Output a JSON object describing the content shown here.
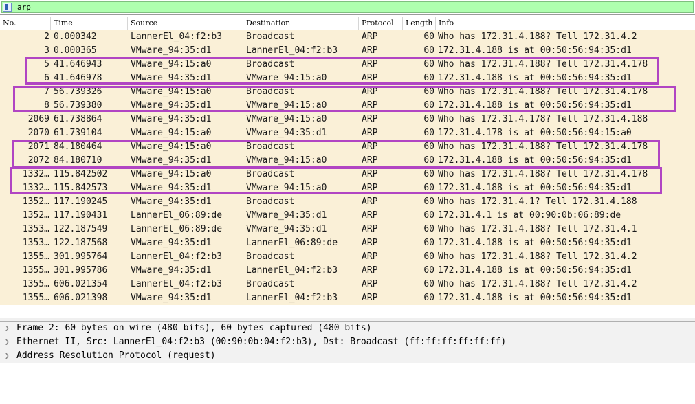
{
  "filter": {
    "value": "arp",
    "icon": "bookmark-icon",
    "colors": {
      "valid_bg": "#afffaf"
    }
  },
  "columns": [
    "No.",
    "Time",
    "Source",
    "Destination",
    "Protocol",
    "Length",
    "Info"
  ],
  "packets": [
    {
      "no": "2",
      "time": "0.000342",
      "src": "LannerEl_04:f2:b3",
      "dst": "Broadcast",
      "proto": "ARP",
      "len": "60",
      "info": "Who has 172.31.4.188? Tell 172.31.4.2"
    },
    {
      "no": "3",
      "time": "0.000365",
      "src": "VMware_94:35:d1",
      "dst": "LannerEl_04:f2:b3",
      "proto": "ARP",
      "len": "60",
      "info": "172.31.4.188 is at 00:50:56:94:35:d1"
    },
    {
      "no": "5",
      "time": "41.646943",
      "src": "VMware_94:15:a0",
      "dst": "Broadcast",
      "proto": "ARP",
      "len": "60",
      "info": "Who has 172.31.4.188? Tell 172.31.4.178"
    },
    {
      "no": "6",
      "time": "41.646978",
      "src": "VMware_94:35:d1",
      "dst": "VMware_94:15:a0",
      "proto": "ARP",
      "len": "60",
      "info": "172.31.4.188 is at 00:50:56:94:35:d1"
    },
    {
      "no": "7",
      "time": "56.739326",
      "src": "VMware_94:15:a0",
      "dst": "Broadcast",
      "proto": "ARP",
      "len": "60",
      "info": "Who has 172.31.4.188? Tell 172.31.4.178"
    },
    {
      "no": "8",
      "time": "56.739380",
      "src": "VMware_94:35:d1",
      "dst": "VMware_94:15:a0",
      "proto": "ARP",
      "len": "60",
      "info": "172.31.4.188 is at 00:50:56:94:35:d1"
    },
    {
      "no": "2069",
      "time": "61.738864",
      "src": "VMware_94:35:d1",
      "dst": "VMware_94:15:a0",
      "proto": "ARP",
      "len": "60",
      "info": "Who has 172.31.4.178? Tell 172.31.4.188"
    },
    {
      "no": "2070",
      "time": "61.739104",
      "src": "VMware_94:15:a0",
      "dst": "VMware_94:35:d1",
      "proto": "ARP",
      "len": "60",
      "info": "172.31.4.178 is at 00:50:56:94:15:a0"
    },
    {
      "no": "2071",
      "time": "84.180464",
      "src": "VMware_94:15:a0",
      "dst": "Broadcast",
      "proto": "ARP",
      "len": "60",
      "info": "Who has 172.31.4.188? Tell 172.31.4.178"
    },
    {
      "no": "2072",
      "time": "84.180710",
      "src": "VMware_94:35:d1",
      "dst": "VMware_94:15:a0",
      "proto": "ARP",
      "len": "60",
      "info": "172.31.4.188 is at 00:50:56:94:35:d1"
    },
    {
      "no": "1332…",
      "time": "115.842502",
      "src": "VMware_94:15:a0",
      "dst": "Broadcast",
      "proto": "ARP",
      "len": "60",
      "info": "Who has 172.31.4.188? Tell 172.31.4.178"
    },
    {
      "no": "1332…",
      "time": "115.842573",
      "src": "VMware_94:35:d1",
      "dst": "VMware_94:15:a0",
      "proto": "ARP",
      "len": "60",
      "info": "172.31.4.188 is at 00:50:56:94:35:d1"
    },
    {
      "no": "1352…",
      "time": "117.190245",
      "src": "VMware_94:35:d1",
      "dst": "Broadcast",
      "proto": "ARP",
      "len": "60",
      "info": "Who has 172.31.4.1? Tell 172.31.4.188"
    },
    {
      "no": "1352…",
      "time": "117.190431",
      "src": "LannerEl_06:89:de",
      "dst": "VMware_94:35:d1",
      "proto": "ARP",
      "len": "60",
      "info": "172.31.4.1 is at 00:90:0b:06:89:de"
    },
    {
      "no": "1353…",
      "time": "122.187549",
      "src": "LannerEl_06:89:de",
      "dst": "VMware_94:35:d1",
      "proto": "ARP",
      "len": "60",
      "info": "Who has 172.31.4.188? Tell 172.31.4.1"
    },
    {
      "no": "1353…",
      "time": "122.187568",
      "src": "VMware_94:35:d1",
      "dst": "LannerEl_06:89:de",
      "proto": "ARP",
      "len": "60",
      "info": "172.31.4.188 is at 00:50:56:94:35:d1"
    },
    {
      "no": "1355…",
      "time": "301.995764",
      "src": "LannerEl_04:f2:b3",
      "dst": "Broadcast",
      "proto": "ARP",
      "len": "60",
      "info": "Who has 172.31.4.188? Tell 172.31.4.2"
    },
    {
      "no": "1355…",
      "time": "301.995786",
      "src": "VMware_94:35:d1",
      "dst": "LannerEl_04:f2:b3",
      "proto": "ARP",
      "len": "60",
      "info": "172.31.4.188 is at 00:50:56:94:35:d1"
    },
    {
      "no": "1355…",
      "time": "606.021354",
      "src": "LannerEl_04:f2:b3",
      "dst": "Broadcast",
      "proto": "ARP",
      "len": "60",
      "info": "Who has 172.31.4.188? Tell 172.31.4.2"
    },
    {
      "no": "1355…",
      "time": "606.021398",
      "src": "VMware_94:35:d1",
      "dst": "LannerEl_04:f2:b3",
      "proto": "ARP",
      "len": "60",
      "info": "172.31.4.188 is at 00:50:56:94:35:d1"
    }
  ],
  "details": [
    {
      "text": "Frame 2: 60 bytes on wire (480 bits), 60 bytes captured (480 bits)",
      "icon": "chevron-right-icon"
    },
    {
      "text": "Ethernet II, Src: LannerEl_04:f2:b3 (00:90:0b:04:f2:b3), Dst: Broadcast (ff:ff:ff:ff:ff:ff)",
      "icon": "chevron-right-icon"
    },
    {
      "text": "Address Resolution Protocol (request)",
      "icon": "chevron-right-icon"
    }
  ],
  "colors": {
    "arp_row_bg": "#faf0d7",
    "annotation_box": "#b145c3"
  }
}
